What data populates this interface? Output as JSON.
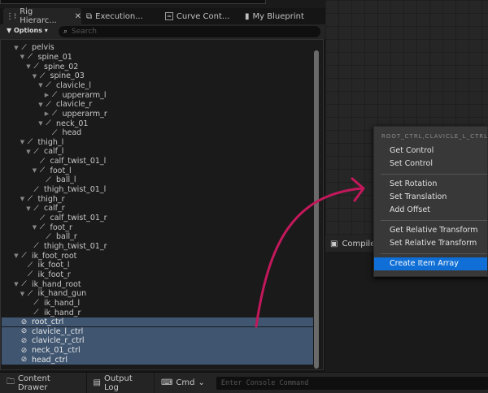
{
  "tabs": [
    {
      "label": "Rig Hierarc...",
      "icon": "hierarchy-icon"
    },
    {
      "label": "Execution...",
      "icon": "execution-icon"
    },
    {
      "label": "Curve Cont...",
      "icon": "curve-icon"
    },
    {
      "label": "My Blueprint",
      "icon": "book-icon"
    }
  ],
  "toolbar": {
    "options_label": "Options",
    "search_placeholder": "Search"
  },
  "tree": [
    {
      "label": "pelvis",
      "level": 1,
      "arrow": "down"
    },
    {
      "label": "spine_01",
      "level": 2,
      "arrow": "down"
    },
    {
      "label": "spine_02",
      "level": 3,
      "arrow": "down"
    },
    {
      "label": "spine_03",
      "level": 4,
      "arrow": "down"
    },
    {
      "label": "clavicle_l",
      "level": 5,
      "arrow": "down"
    },
    {
      "label": "upperarm_l",
      "level": 6,
      "arrow": "right"
    },
    {
      "label": "clavicle_r",
      "level": 5,
      "arrow": "down"
    },
    {
      "label": "upperarm_r",
      "level": 6,
      "arrow": "right"
    },
    {
      "label": "neck_01",
      "level": 5,
      "arrow": "down"
    },
    {
      "label": "head",
      "level": 6,
      "arrow": ""
    },
    {
      "label": "thigh_l",
      "level": 2,
      "arrow": "down"
    },
    {
      "label": "calf_l",
      "level": 3,
      "arrow": "down"
    },
    {
      "label": "calf_twist_01_l",
      "level": 4,
      "arrow": ""
    },
    {
      "label": "foot_l",
      "level": 4,
      "arrow": "down"
    },
    {
      "label": "ball_l",
      "level": 5,
      "arrow": ""
    },
    {
      "label": "thigh_twist_01_l",
      "level": 3,
      "arrow": ""
    },
    {
      "label": "thigh_r",
      "level": 2,
      "arrow": "down"
    },
    {
      "label": "calf_r",
      "level": 3,
      "arrow": "down"
    },
    {
      "label": "calf_twist_01_r",
      "level": 4,
      "arrow": ""
    },
    {
      "label": "foot_r",
      "level": 4,
      "arrow": "down"
    },
    {
      "label": "ball_r",
      "level": 5,
      "arrow": ""
    },
    {
      "label": "thigh_twist_01_r",
      "level": 3,
      "arrow": ""
    },
    {
      "label": "ik_foot_root",
      "level": 1,
      "arrow": "down"
    },
    {
      "label": "ik_foot_l",
      "level": 2,
      "arrow": ""
    },
    {
      "label": "ik_foot_r",
      "level": 2,
      "arrow": ""
    },
    {
      "label": "ik_hand_root",
      "level": 1,
      "arrow": "down"
    },
    {
      "label": "ik_hand_gun",
      "level": 2,
      "arrow": "down"
    },
    {
      "label": "ik_hand_l",
      "level": 3,
      "arrow": ""
    },
    {
      "label": "ik_hand_r",
      "level": 3,
      "arrow": ""
    },
    {
      "label": "root_ctrl",
      "level": 0,
      "arrow": "",
      "type": "control",
      "selected": true
    },
    {
      "label": "clavicle_l_ctrl",
      "level": 0,
      "arrow": "",
      "type": "control",
      "selected": true
    },
    {
      "label": "clavicle_r_ctrl",
      "level": 0,
      "arrow": "",
      "type": "control",
      "selected": true
    },
    {
      "label": "neck_01_ctrl",
      "level": 0,
      "arrow": "",
      "type": "control",
      "selected": true
    },
    {
      "label": "head_ctrl",
      "level": 0,
      "arrow": "",
      "type": "control",
      "selected": true
    }
  ],
  "compiler_tab": "Compiler",
  "context_menu": {
    "header": "ROOT_CTRL,CLAVICLE_L_CTRL,CLAVICLE_R_CTRL",
    "groups": [
      [
        "Get Control",
        "Set Control"
      ],
      [
        "Set Rotation",
        "Set Translation",
        "Add Offset"
      ],
      [
        "Get Relative Transform",
        "Set Relative Transform"
      ],
      [
        "Create Item Array"
      ]
    ],
    "highlighted": "Create Item Array"
  },
  "bottom": {
    "content_drawer": "Content Drawer",
    "output_log": "Output Log",
    "cmd": "Cmd",
    "console_placeholder": "Enter Console Command"
  },
  "colors": {
    "accent": "#0f6fd6",
    "selection": "#3f5570",
    "annotation": "#c2185b"
  }
}
